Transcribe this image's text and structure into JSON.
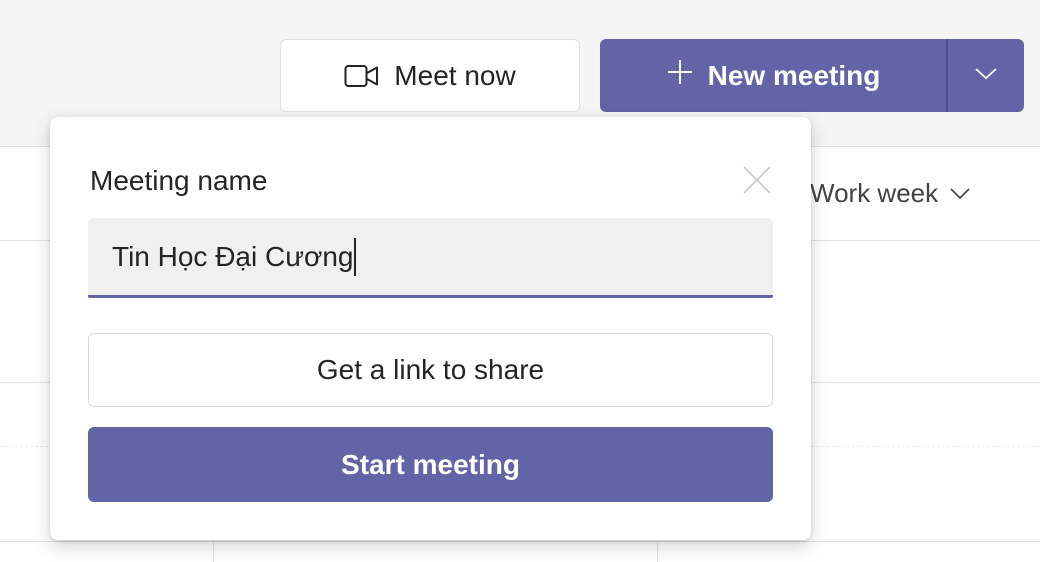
{
  "toolbar": {
    "meet_now_label": "Meet now",
    "new_meeting_label": "New meeting"
  },
  "calendar": {
    "view_label": "Work week"
  },
  "popup": {
    "title": "Meeting name",
    "meeting_name_value": "Tin Học Đại Cương",
    "link_button_label": "Get a link to share",
    "start_button_label": "Start meeting"
  },
  "colors": {
    "brand_purple": "#6264a7",
    "background": "#f5f5f5",
    "input_background": "#f0f0f0"
  },
  "icons": {
    "meet_now": "video-camera-icon",
    "new_meeting": "plus-icon",
    "new_meeting_dropdown": "chevron-down-icon",
    "view_dropdown": "chevron-down-icon",
    "close": "close-icon"
  }
}
